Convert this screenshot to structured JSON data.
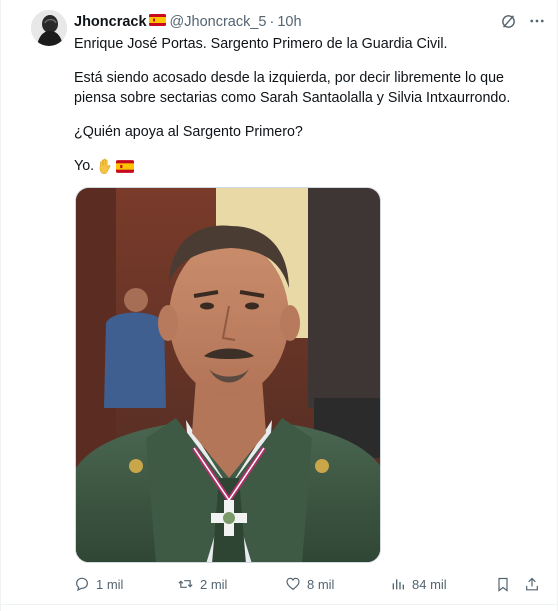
{
  "post": {
    "display_name": "Jhoncrack",
    "handle": "@Jhoncrack_5",
    "separator": "·",
    "time": "10h",
    "paragraphs": {
      "p1": "Enrique José Portas. Sargento Primero de la Guardia Civil.",
      "p2": "Está siendo acosado desde la izquierda, por decir libremente lo que piensa sobre sectarias como Sarah Santaolalla y Silvia Intxaurrondo.",
      "p3": "¿Quién apoya al Sargento Primero?",
      "p4": "Yo."
    },
    "emoji": [
      "raised-hand",
      "spain-flag"
    ]
  },
  "actions": {
    "replies": "1 mil",
    "reposts": "2 mil",
    "likes": "8 mil",
    "views": "84 mil"
  },
  "colors": {
    "text": "#0f1419",
    "secondary": "#536471",
    "border": "#eff3f4",
    "uniform_green": "#3f5a44"
  },
  "icons": [
    "grok-icon",
    "more-icon",
    "reply-icon",
    "repost-icon",
    "like-icon",
    "views-icon",
    "bookmark-icon",
    "share-icon"
  ]
}
